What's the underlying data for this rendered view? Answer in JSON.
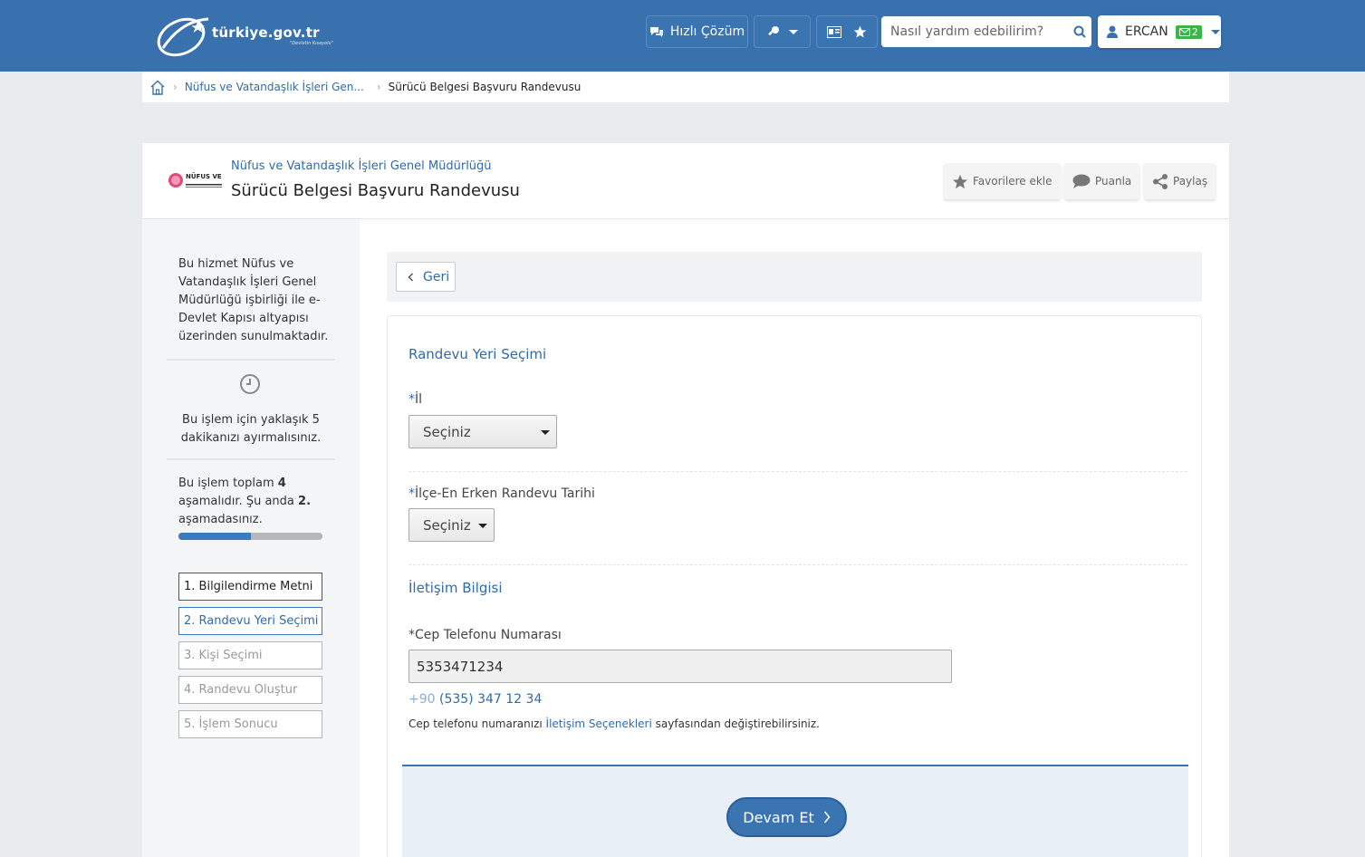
{
  "header": {
    "logo_text": "türkiye.gov.tr",
    "logo_subtext": "\"Devletin Kısayolu\"",
    "quick_solution_label": "Hızlı Çözüm",
    "search_placeholder": "Nasıl yardım edebilirim?",
    "user_name": "ERCAN",
    "message_count": "2"
  },
  "breadcrumb": {
    "items": [
      "Nüfus ve Vatandaşlık İşleri Gen...",
      "Sürücü Belgesi Başvuru Randevusu"
    ]
  },
  "service": {
    "institution_logo_text": "NÜFUS VE",
    "institution_name": "Nüfus ve Vatandaşlık İşleri Genel Müdürlüğü",
    "title": "Sürücü Belgesi Başvuru Randevusu",
    "actions": [
      "Favorilere ekle",
      "Puanla",
      "Paylaş"
    ]
  },
  "sidebar": {
    "info_text": "Bu hizmet Nüfus ve Vatandaşlık İşleri Genel Müdürlüğü işbirliği ile e-Devlet Kapısı altyapısı üzerinden sunulmaktadır.",
    "time_text": "Bu işlem için yaklaşık 5 dakikanızı ayırmalısınız.",
    "steps_text_1": "Bu işlem toplam ",
    "steps_total": "4",
    "steps_text_2": " aşamalıdır. Şu anda ",
    "steps_current": "2.",
    "steps_text_3": " aşamadasınız.",
    "progress_fraction": 0.5,
    "steps": [
      "1. Bilgilendirme Metni",
      "2. Randevu Yeri Seçimi",
      "3. Kişi Seçimi",
      "4. Randevu Oluştur",
      "5. İşlem Sonucu"
    ]
  },
  "content": {
    "back_label": "Geri",
    "section1_title": "Randevu Yeri Seçimi",
    "required_mark": "*",
    "field_il_label": "İl",
    "field_il_value": "Seçiniz",
    "field_ilce_label": "İlçe-En Erken Randevu Tarihi",
    "field_ilce_value": "Seçiniz",
    "section2_title": "İletişim Bilgisi",
    "phone_label": "Cep Telefonu Numarası",
    "phone_value": "5353471234",
    "phone_country_code": "+90",
    "phone_formatted": "(535) 347 12 34",
    "phone_note_1": "Cep telefonu numaranızı ",
    "phone_note_link": "İletişim Seçenekleri",
    "phone_note_2": " sayfasından değiştirebilirsiniz.",
    "continue_label": "Devam Et"
  },
  "colors": {
    "header_blue": "#3871ad",
    "link_blue": "#2f6ba8",
    "badge_green": "#3bb54a"
  }
}
